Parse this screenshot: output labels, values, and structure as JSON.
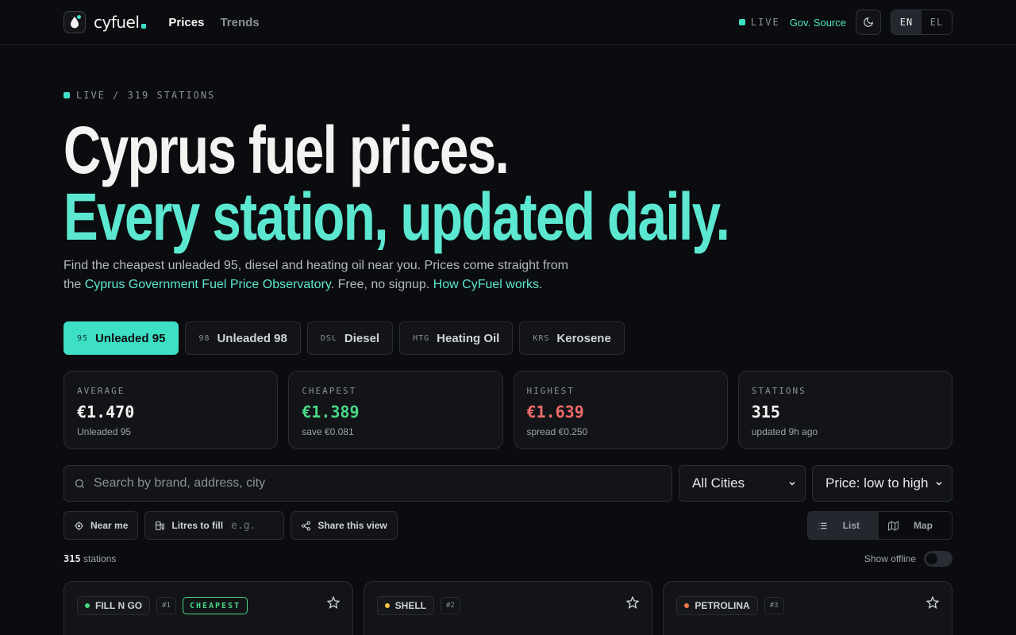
{
  "header": {
    "logo_text": "cyfuel",
    "nav": [
      {
        "label": "Prices",
        "active": true
      },
      {
        "label": "Trends",
        "active": false
      }
    ],
    "live_label": "LIVE",
    "gov_source_label": "Gov. Source",
    "lang": [
      {
        "label": "EN",
        "active": true
      },
      {
        "label": "EL",
        "active": false
      }
    ]
  },
  "hero": {
    "eyebrow": "LIVE / 319 STATIONS",
    "title_line1": "Cyprus fuel prices.",
    "title_line2": "Every station, updated daily.",
    "lede_part1": "Find the cheapest unleaded 95, diesel and heating oil near you. Prices come straight from the ",
    "lede_link1": "Cyprus Government Fuel Price Observatory",
    "lede_part2": ". Free, no signup. ",
    "lede_link2": "How CyFuel works."
  },
  "fuel_tabs": [
    {
      "code": "95",
      "label": "Unleaded 95",
      "active": true
    },
    {
      "code": "98",
      "label": "Unleaded 98",
      "active": false
    },
    {
      "code": "DSL",
      "label": "Diesel",
      "active": false
    },
    {
      "code": "HTG",
      "label": "Heating Oil",
      "active": false
    },
    {
      "code": "KRS",
      "label": "Kerosene",
      "active": false
    }
  ],
  "stats": [
    {
      "label": "AVERAGE",
      "value": "€1.470",
      "sub": "Unleaded 95",
      "tone": "neutral"
    },
    {
      "label": "CHEAPEST",
      "value": "€1.389",
      "sub": "save €0.081",
      "tone": "green"
    },
    {
      "label": "HIGHEST",
      "value": "€1.639",
      "sub": "spread €0.250",
      "tone": "red"
    },
    {
      "label": "STATIONS",
      "value": "315",
      "sub": "updated 9h ago",
      "tone": "neutral"
    }
  ],
  "search": {
    "placeholder": "Search by brand, address, city",
    "city_value": "All Cities",
    "sort_value": "Price: low to high"
  },
  "tools": {
    "near_me": "Near me",
    "litres_label": "Litres to fill",
    "litres_placeholder": "e.g.",
    "share": "Share this view",
    "view_list": "List",
    "view_map": "Map"
  },
  "results": {
    "count": "315",
    "count_suffix": "stations",
    "show_offline": "Show offline"
  },
  "cards": [
    {
      "brand": "FILL N GO",
      "rank": "#1",
      "tag": "CHEAPEST",
      "dot_color": "#4ad886"
    },
    {
      "brand": "SHELL",
      "rank": "#2",
      "tag": "",
      "dot_color": "#f5c542"
    },
    {
      "brand": "PETROLINA",
      "rank": "#3",
      "tag": "",
      "dot_color": "#f07a4a"
    }
  ],
  "colors": {
    "accent": "#3ee0c5",
    "green": "#4ad886",
    "red": "#f06b6b",
    "background": "#0b0c0f"
  }
}
